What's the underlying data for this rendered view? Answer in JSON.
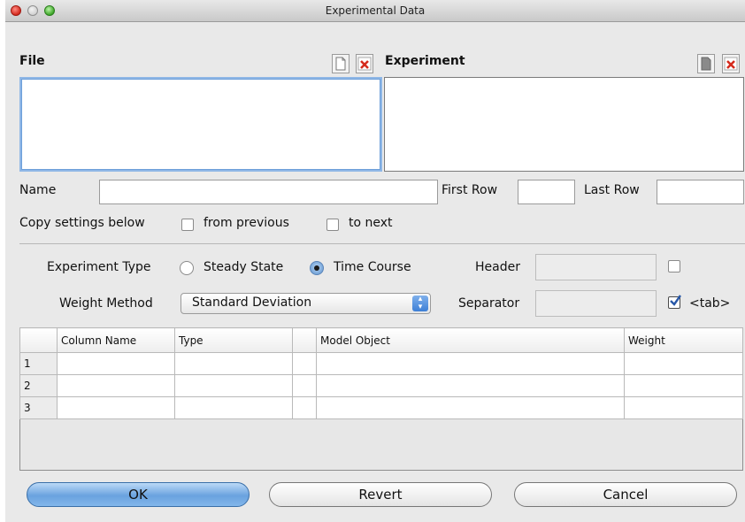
{
  "window": {
    "title": "Experimental Data"
  },
  "file": {
    "label": "File"
  },
  "experiment": {
    "label": "Experiment"
  },
  "name": {
    "label": "Name",
    "value": ""
  },
  "first_row": {
    "label": "First Row",
    "value": ""
  },
  "last_row": {
    "label": "Last Row",
    "value": ""
  },
  "copy": {
    "label": "Copy settings below",
    "from_previous": "from previous",
    "to_next": "to next",
    "from_previous_checked": false,
    "to_next_checked": false
  },
  "experiment_type": {
    "label": "Experiment Type",
    "options": [
      "Steady State",
      "Time Course"
    ],
    "selected": "Time Course"
  },
  "header": {
    "label": "Header",
    "value": "",
    "checked": false
  },
  "weight_method": {
    "label": "Weight Method",
    "value": "Standard Deviation"
  },
  "separator": {
    "label": "Separator",
    "value": "",
    "tab_label": "<tab>",
    "tab_checked": true
  },
  "table": {
    "columns": [
      "Column Name",
      "Type",
      "",
      "Model Object",
      "Weight"
    ],
    "rows": [
      {
        "num": "1",
        "cells": [
          "",
          "",
          "",
          "",
          ""
        ]
      },
      {
        "num": "2",
        "cells": [
          "",
          "",
          "",
          "",
          ""
        ]
      },
      {
        "num": "3",
        "cells": [
          "",
          "",
          "",
          "",
          ""
        ]
      }
    ]
  },
  "buttons": {
    "ok": "OK",
    "revert": "Revert",
    "cancel": "Cancel"
  },
  "icons": {
    "new_file": "new-document-icon",
    "delete_file": "delete-icon",
    "new_experiment": "new-document-icon",
    "delete_experiment": "delete-icon"
  },
  "colors": {
    "focus": "#8fb7e6",
    "default_button": "#6aa2df",
    "delete_red": "#d42a1c"
  }
}
